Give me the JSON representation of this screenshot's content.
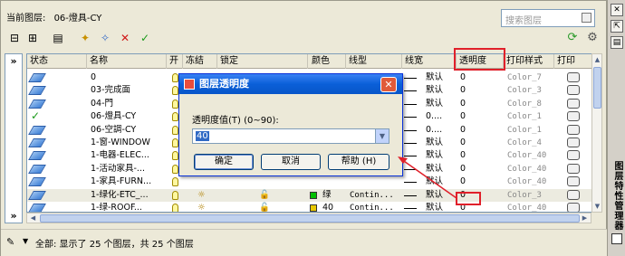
{
  "header": {
    "current_layer_label": "当前图层:",
    "current_layer_value": "06-燈具-CY",
    "search_placeholder": "搜索图层"
  },
  "toolbar": {
    "icons": [
      "new-property-filter-icon",
      "new-group-filter-icon",
      "layer-states-manager-icon",
      "new-layer-icon",
      "new-layer-vp-frozen-icon",
      "delete-layer-icon",
      "set-current-icon"
    ],
    "right_icons": [
      "refresh-icon",
      "settings-icon"
    ]
  },
  "columns": [
    "状态",
    "名称",
    "开",
    "冻结",
    "锁定",
    "颜色",
    "线型",
    "线宽",
    "透明度",
    "打印样式",
    "打印"
  ],
  "layers": [
    {
      "status": "layer",
      "name": "0",
      "lineweight": "默认",
      "transparency": "0",
      "plot_style": "Color_7"
    },
    {
      "status": "layer",
      "name": "03-完成面",
      "lineweight": "默认",
      "transparency": "0",
      "plot_style": "Color_3"
    },
    {
      "status": "layer",
      "name": "04-門",
      "lineweight": "默认",
      "transparency": "0",
      "plot_style": "Color_8"
    },
    {
      "status": "current",
      "name": "06-燈具-CY",
      "lineweight": "0....",
      "transparency": "0",
      "plot_style": "Color_1"
    },
    {
      "status": "layer",
      "name": "06-空調-CY",
      "lineweight": "0....",
      "transparency": "0",
      "plot_style": "Color_1"
    },
    {
      "status": "layer",
      "name": "1-窗-WINDOW",
      "lineweight": "默认",
      "transparency": "0",
      "plot_style": "Color_4"
    },
    {
      "status": "layer",
      "name": "1-电器-ELEC...",
      "lineweight": "默认",
      "transparency": "0",
      "plot_style": "Color_40"
    },
    {
      "status": "layer",
      "name": "1-活动家具-...",
      "lineweight": "默认",
      "transparency": "0",
      "plot_style": "Color_40"
    },
    {
      "status": "layer",
      "name": "1-家具-FURN...",
      "lineweight": "默认",
      "transparency": "0",
      "plot_style": "Color_40"
    },
    {
      "status": "layer",
      "name": "1-绿化-ETC_...",
      "color_name": "绿",
      "linetype": "Contin...",
      "lineweight": "默认",
      "transparency": "0",
      "plot_style": "Color_3",
      "selected": true
    },
    {
      "status": "layer",
      "name": "1-绿-ROOF...",
      "color_name": "40",
      "linetype": "Contin...",
      "lineweight": "默认",
      "transparency": "0",
      "plot_style": "Color_40"
    }
  ],
  "dialog": {
    "title": "图层透明度",
    "label": "透明度值(T) (0~90):",
    "value": "40",
    "ok": "确定",
    "cancel": "取消",
    "help": "帮助 (H)"
  },
  "statusbar": {
    "text": "全部: 显示了 25 个图层，共 25 个图层"
  },
  "right_panel": {
    "title": "图层特性管理器"
  },
  "colors": {
    "highlight_red": "#e0202a",
    "green_swatch": "#00c000",
    "yellow_swatch": "#e8c800",
    "title_blue": "#0a5fd8"
  }
}
